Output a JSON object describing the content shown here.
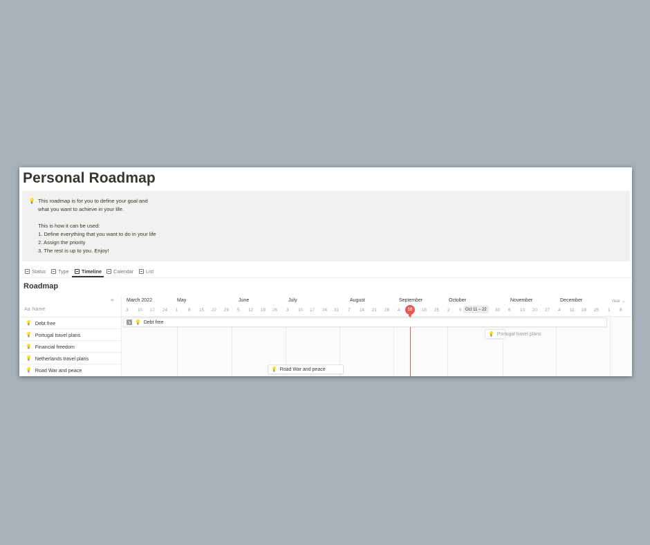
{
  "page": {
    "title": "Personal Roadmap"
  },
  "callout": {
    "icon": "lightbulb-icon",
    "lines": [
      "This roadmap is for you to define your goal and",
      "what you want to achieve in your life.",
      "",
      "This is how it can be used:",
      "1. Define everything that you want to do in your life",
      "2. Assign the priority",
      "3. The rest is up to you. Enjoy!"
    ]
  },
  "tabs": [
    {
      "label": "Status",
      "icon": "board-icon"
    },
    {
      "label": "Type",
      "icon": "board-icon"
    },
    {
      "label": "Timeline",
      "icon": "timeline-icon",
      "active": true
    },
    {
      "label": "Calendar",
      "icon": "calendar-icon"
    },
    {
      "label": "List",
      "icon": "list-icon"
    }
  ],
  "view": {
    "title": "Roadmap",
    "name_header": "Name",
    "collapse_icon": "double-chevron-left-icon"
  },
  "rows": [
    {
      "name": "Debt free"
    },
    {
      "name": "Portugal travel plans"
    },
    {
      "name": "Financial freedom"
    },
    {
      "name": "Netherlands travel plans"
    },
    {
      "name": "Road War and peace"
    }
  ],
  "timeline": {
    "months": [
      "March 2022",
      "May",
      "June",
      "July",
      "August",
      "September",
      "October",
      "November",
      "December"
    ],
    "days": [
      "3",
      "10",
      "17",
      "24",
      "1",
      "8",
      "15",
      "22",
      "29",
      "5",
      "12",
      "19",
      "26",
      "3",
      "10",
      "17",
      "24",
      "31",
      "7",
      "14",
      "21",
      "28",
      "4",
      "10",
      "18",
      "25",
      "2",
      "9",
      "30",
      "6",
      "13",
      "20",
      "27",
      "4",
      "11",
      "18",
      "25",
      "1",
      "8"
    ],
    "today": "10",
    "range_label": "Oct 11 – 22",
    "zoom": "Year",
    "bars": [
      {
        "label": "Debt free",
        "row": 0
      },
      {
        "label": "Portugal travel plans",
        "row": 1
      },
      {
        "label": "Road War and peace",
        "row": 4
      }
    ]
  },
  "colors": {
    "accent_today": "#eb5757",
    "icon_bulb": "#e9b53b",
    "background": "#a6b1ba"
  }
}
